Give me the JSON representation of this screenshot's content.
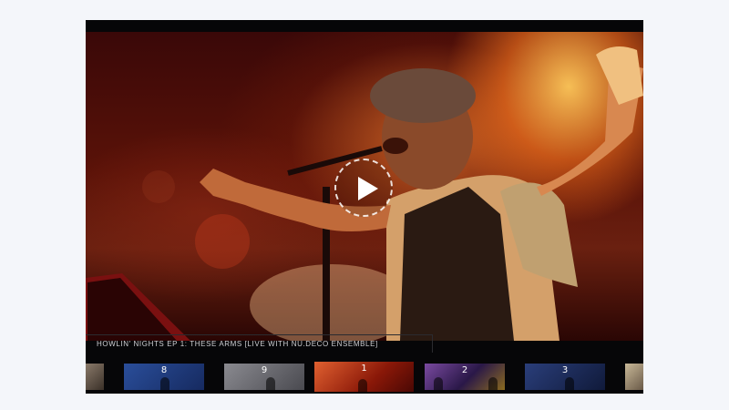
{
  "player": {
    "title": "HOWLIN' NIGHTS EP 1: THESE ARMS [LIVE WITH NU.DECO ENSEMBLE]",
    "play_label": "Play video",
    "playlist": [
      {
        "label": "",
        "color": "#8a7a6a"
      },
      {
        "label": "8",
        "color": "#2a4e9a"
      },
      {
        "label": "9",
        "color": "#6a6a70"
      },
      {
        "label": "1",
        "color": "#b02a10"
      },
      {
        "label": "2",
        "color": "#7a4aa0"
      },
      {
        "label": "3",
        "color": "#2a3e7a"
      },
      {
        "label": "",
        "color": "#b8a890"
      }
    ]
  }
}
